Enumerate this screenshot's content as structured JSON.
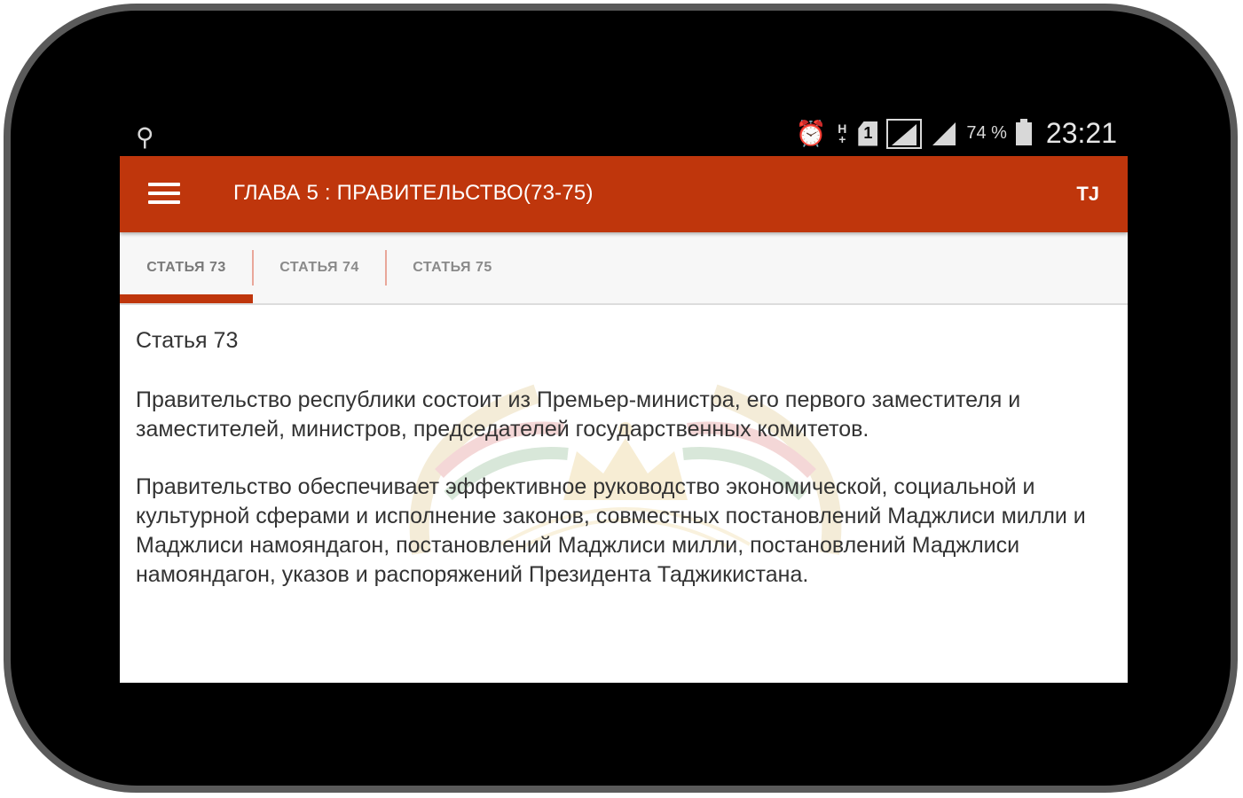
{
  "status_bar": {
    "usb_icon": "usb-icon",
    "network_type": "H\n+",
    "sim_slot": "1",
    "battery_percent": "74 %",
    "time": "23:21"
  },
  "app_bar": {
    "title": "ГЛАВА 5 : ПРАВИТЕЛЬСТВО(73-75)",
    "lang_label": "TJ",
    "accent_color": "#bf360c"
  },
  "tabs": [
    {
      "label": "СТАТЬЯ 73",
      "active": true
    },
    {
      "label": "СТАТЬЯ 74",
      "active": false
    },
    {
      "label": "СТАТЬЯ 75",
      "active": false
    }
  ],
  "article": {
    "heading": "Статья 73",
    "paragraphs": [
      "Правительство республики состоит из Премьер-министра, его первого заместителя и заместителей, министров, председателей государственных комитетов.",
      "Правительство обеспечивает эффективное руководство экономической, социальной и культурной сферами и исполнение законов, совместных постановлений Маджлиси милли и Маджлиси намояндагон, постановлений Маджлиси милли, постановлений Маджлиси намояндагон, указов и распоряжений Президента Таджикистана."
    ]
  }
}
